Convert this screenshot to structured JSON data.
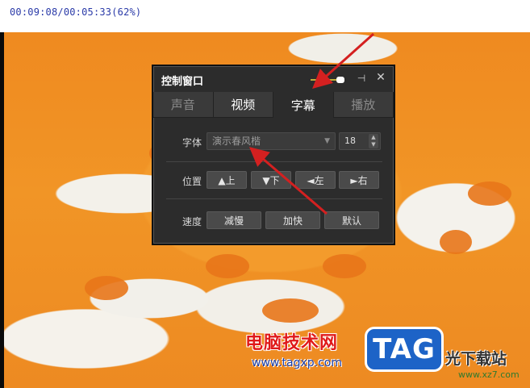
{
  "player": {
    "timecode": "00:09:08/00:05:33(62%)"
  },
  "control_window": {
    "title": "控制窗口",
    "opacity_level": 1.0,
    "tabs": [
      {
        "label": "声音",
        "state": "dim"
      },
      {
        "label": "视频",
        "state": "normal"
      },
      {
        "label": "字幕",
        "state": "active"
      },
      {
        "label": "播放",
        "state": "dim"
      }
    ],
    "font_row": {
      "label": "字体",
      "font_value": "演示春风楷",
      "size_value": "18"
    },
    "position_row": {
      "label": "位置",
      "buttons": [
        "▲上",
        "▼下",
        "◄左",
        "►右"
      ]
    },
    "speed_row": {
      "label": "速度",
      "buttons": [
        "减慢",
        "加快",
        "默认"
      ]
    }
  },
  "watermark": {
    "cn_name": "电脑技术网",
    "url": "www.tagxp.com",
    "logo_text": "TAG",
    "site_text": "光下载站",
    "site_url": "www.xz7.com"
  },
  "colors": {
    "annotation_arrow": "#d42020",
    "panel_bg": "#2c2c2c",
    "video_orange": "#f0901f"
  }
}
